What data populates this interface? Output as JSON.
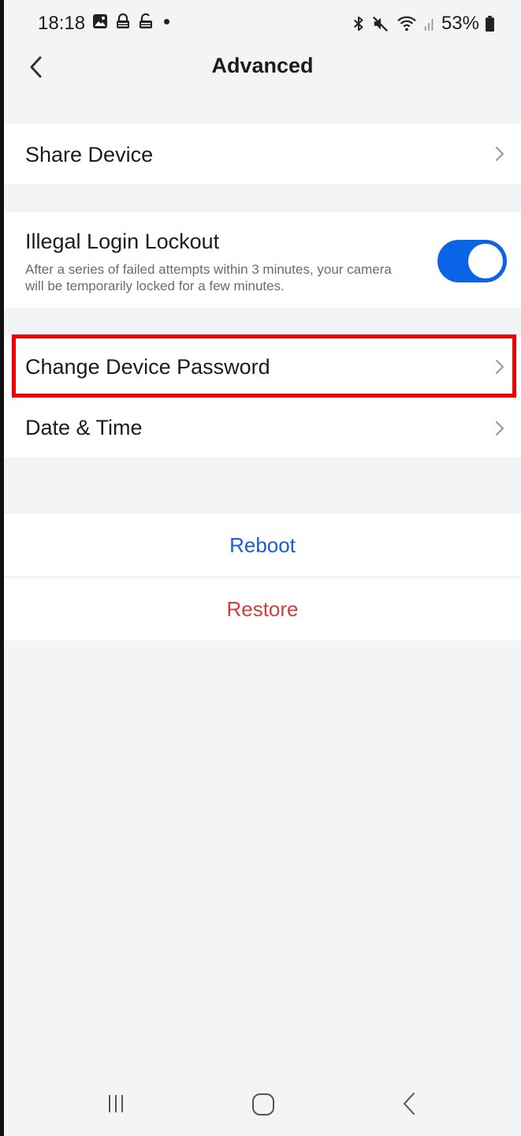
{
  "status_bar": {
    "time": "18:18",
    "battery": "53%",
    "icons_left": [
      "gallery-icon",
      "lock-icon",
      "lock-open-icon",
      "dot-icon"
    ],
    "icons_right": [
      "bluetooth-icon",
      "mute-icon",
      "wifi-icon",
      "signal-icon",
      "battery-icon"
    ]
  },
  "header": {
    "title": "Advanced",
    "back_icon": "chevron-left-icon"
  },
  "sections": {
    "share_device": {
      "label": "Share Device"
    },
    "illegal_login": {
      "label": "Illegal Login Lockout",
      "description": "After a series of failed attempts within 3 minutes, your camera will be temporarily locked for a few minutes.",
      "enabled": true
    },
    "change_password": {
      "label": "Change Device Password"
    },
    "date_time": {
      "label": "Date & Time"
    }
  },
  "actions": {
    "reboot": {
      "label": "Reboot",
      "color": "#1a5fd0"
    },
    "restore": {
      "label": "Restore",
      "color": "#d0403c"
    }
  },
  "colors": {
    "toggle_on": "#0b63e5",
    "highlight": "#ee0000",
    "background": "#f3f4f6"
  },
  "nav_bar": {
    "items": [
      "recent-apps-icon",
      "home-icon",
      "back-icon"
    ]
  }
}
